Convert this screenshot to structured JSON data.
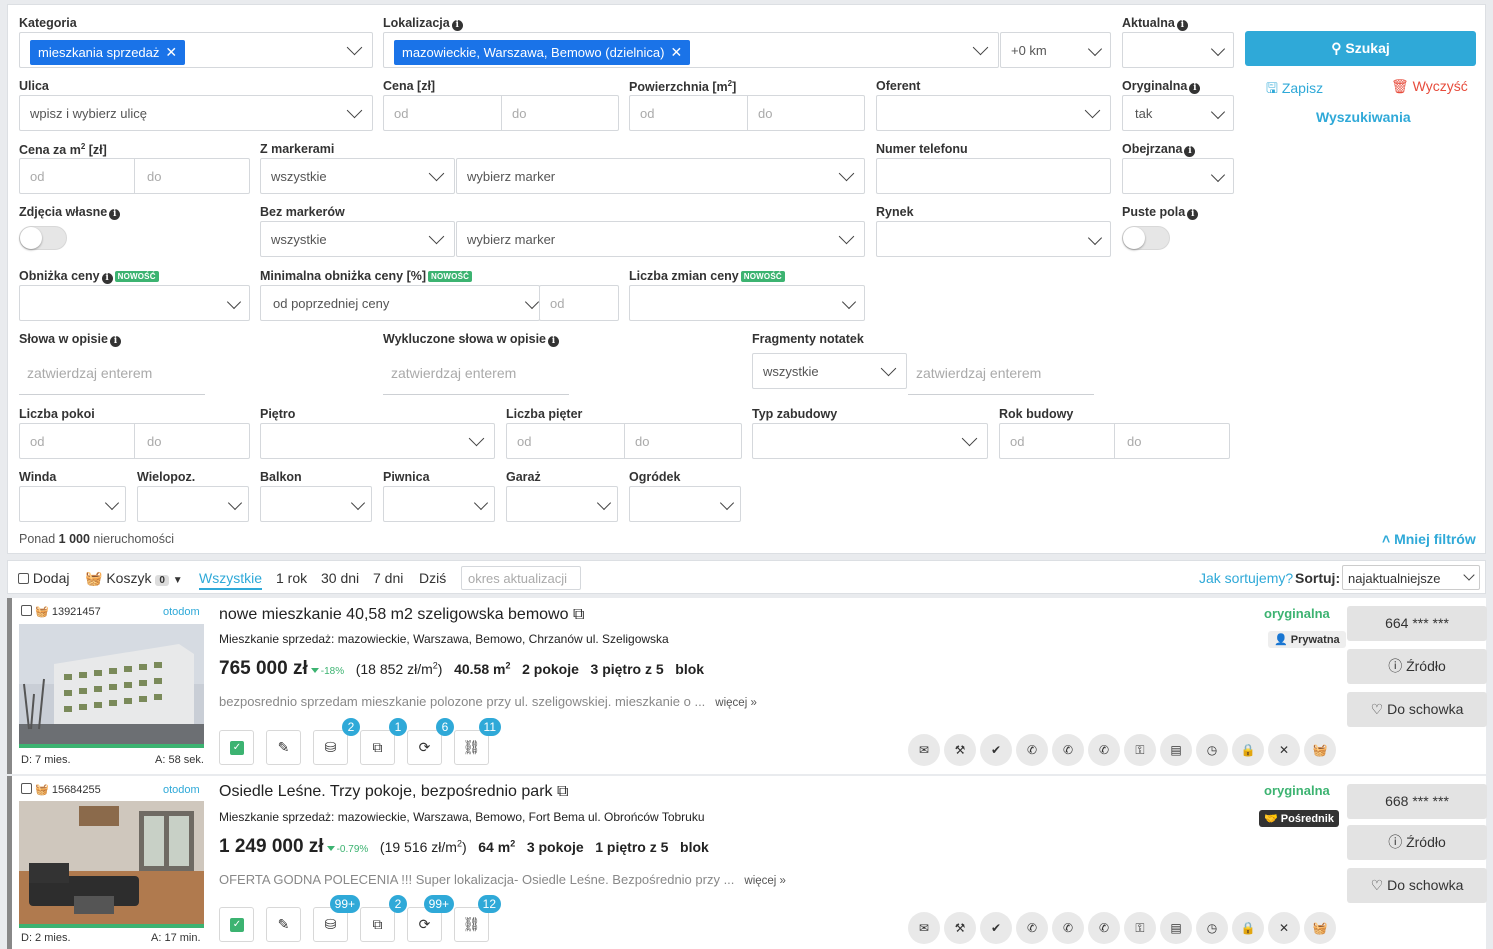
{
  "filters": {
    "kategoria": {
      "label": "Kategoria",
      "tag": "mieszkania sprzedaż"
    },
    "lokalizacja": {
      "label": "Lokalizacja",
      "tag": "mazowieckie, Warszawa, Bemowo (dzielnica)",
      "radius": "+0 km"
    },
    "aktualna": {
      "label": "Aktualna"
    },
    "search_button": "Szukaj",
    "ulica": {
      "label": "Ulica",
      "placeholder": "wpisz i wybierz ulicę"
    },
    "cena": {
      "label": "Cena [zł]",
      "from": "od",
      "to": "do"
    },
    "powierzchnia": {
      "label": "Powierzchnia [m",
      "unit_sup": "2",
      "label_end": "]",
      "from": "od",
      "to": "do"
    },
    "oferent": {
      "label": "Oferent"
    },
    "oryginalna": {
      "label": "Oryginalna",
      "value": "tak"
    },
    "zapisz": "Zapisz",
    "wyczysc": "Wyczyść",
    "wyszukiwania": "Wyszukiwania",
    "cena_m2": {
      "label": "Cena za m",
      "unit_sup": "2",
      "label_end": " [zł]",
      "from": "od",
      "to": "do"
    },
    "z_markerami": {
      "label": "Z markerami",
      "value": "wszystkie",
      "marker_placeholder": "wybierz marker"
    },
    "numer_telefonu": {
      "label": "Numer telefonu"
    },
    "obejrzana": {
      "label": "Obejrzana"
    },
    "zdjecia_wlasne": {
      "label": "Zdjęcia własne"
    },
    "bez_markerow": {
      "label": "Bez markerów",
      "value": "wszystkie",
      "marker_placeholder": "wybierz marker"
    },
    "rynek": {
      "label": "Rynek"
    },
    "puste_pola": {
      "label": "Puste pola"
    },
    "obnizka_ceny": {
      "label": "Obniżka ceny",
      "badge": "NOWOŚĆ"
    },
    "minimalna_obnizka": {
      "label": "Minimalna obniżka ceny [%]",
      "badge": "NOWOŚĆ",
      "value": "od poprzedniej ceny",
      "from": "od"
    },
    "liczba_zmian": {
      "label": "Liczba zmian ceny",
      "badge": "NOWOŚĆ"
    },
    "slowa_w_opisie": {
      "label": "Słowa w opisie",
      "placeholder": "zatwierdzaj enterem"
    },
    "wykluczone_slowa": {
      "label": "Wykluczone słowa w opisie",
      "placeholder": "zatwierdzaj enterem"
    },
    "fragmenty_notatek": {
      "label": "Fragmenty notatek",
      "value": "wszystkie",
      "placeholder": "zatwierdzaj enterem"
    },
    "liczba_pokoi": {
      "label": "Liczba pokoi",
      "from": "od",
      "to": "do"
    },
    "pietro": {
      "label": "Piętro"
    },
    "liczba_pieter": {
      "label": "Liczba pięter",
      "from": "od",
      "to": "do"
    },
    "typ_zabudowy": {
      "label": "Typ zabudowy"
    },
    "rok_budowy": {
      "label": "Rok budowy",
      "from": "od",
      "to": "do"
    },
    "winda": {
      "label": "Winda"
    },
    "wielopoz": {
      "label": "Wielopoz."
    },
    "balkon": {
      "label": "Balkon"
    },
    "piwnica": {
      "label": "Piwnica"
    },
    "garaz": {
      "label": "Garaż"
    },
    "ogrodek": {
      "label": "Ogródek"
    },
    "result_prefix": "Ponad",
    "result_count": "1 000",
    "result_suffix": "nieruchomości",
    "mniej_filtrow": "Mniej filtrów"
  },
  "toolbar": {
    "dodaj": "Dodaj",
    "koszyk": "Koszyk",
    "koszyk_count": "0",
    "periods": [
      "Wszystkie",
      "1 rok",
      "30 dni",
      "7 dni",
      "Dziś"
    ],
    "okres_placeholder": "okres aktualizacji",
    "jak_sortujemy": "Jak sortujemy?",
    "sortuj_label": "Sortuj:",
    "sortuj_value": "najaktualniejsze"
  },
  "listings": [
    {
      "id": "13921457",
      "source": "otodom",
      "title": "nowe mieszkanie 40,58 m2 szeligowska bemowo",
      "address": "Mieszkanie sprzedaż: mazowieckie, Warszawa, Bemowo, Chrzanów ul. Szeligowska",
      "price": "765 000 zł",
      "drop": "-18%",
      "price_m2": "(18 852 zł/m",
      "price_m2_end": ")",
      "area": "40.58 m",
      "rooms": "2 pokoje",
      "floor": "3 piętro z 5",
      "type": "blok",
      "desc": "bezposrednio sprzedam mieszkanie polozone przy ul. szeligowskiej. mieszkanie o ...",
      "more": "więcej »",
      "age_d": "D: 7 mies.",
      "age_a": "A: 58 sek.",
      "counts": [
        "2",
        "1",
        "6",
        "11"
      ],
      "status": "oryginalna",
      "seller": "Prywatna",
      "phone": "664 *** ***",
      "zrodlo": "Źródło",
      "schowek": "Do schowka"
    },
    {
      "id": "15684255",
      "source": "otodom",
      "title": "Osiedle Leśne. Trzy pokoje, bezpośrednio park",
      "address": "Mieszkanie sprzedaż: mazowieckie, Warszawa, Bemowo, Fort Bema ul. Obrońców Tobruku",
      "price": "1 249 000 zł",
      "drop": "-0.79%",
      "price_m2": "(19 516 zł/m",
      "price_m2_end": ")",
      "area": "64 m",
      "rooms": "3 pokoje",
      "floor": "1 piętro z 5",
      "type": "blok",
      "desc": "OFERTA GODNA POLECENIA !!! Super lokalizacja- Osiedle Leśne. Bezpośrednio przy ...",
      "more": "więcej »",
      "age_d": "D: 2 mies.",
      "age_a": "A: 17 min.",
      "counts": [
        "99+",
        "2",
        "99+",
        "12"
      ],
      "status": "oryginalna",
      "seller": "Pośrednik",
      "phone": "668 *** ***",
      "zrodlo": "Źródło",
      "schowek": "Do schowka"
    }
  ],
  "colors": {
    "accent": "#2fa9d8",
    "tag": "#1a73e8",
    "green": "#3cb371",
    "danger": "#e74c3c"
  }
}
